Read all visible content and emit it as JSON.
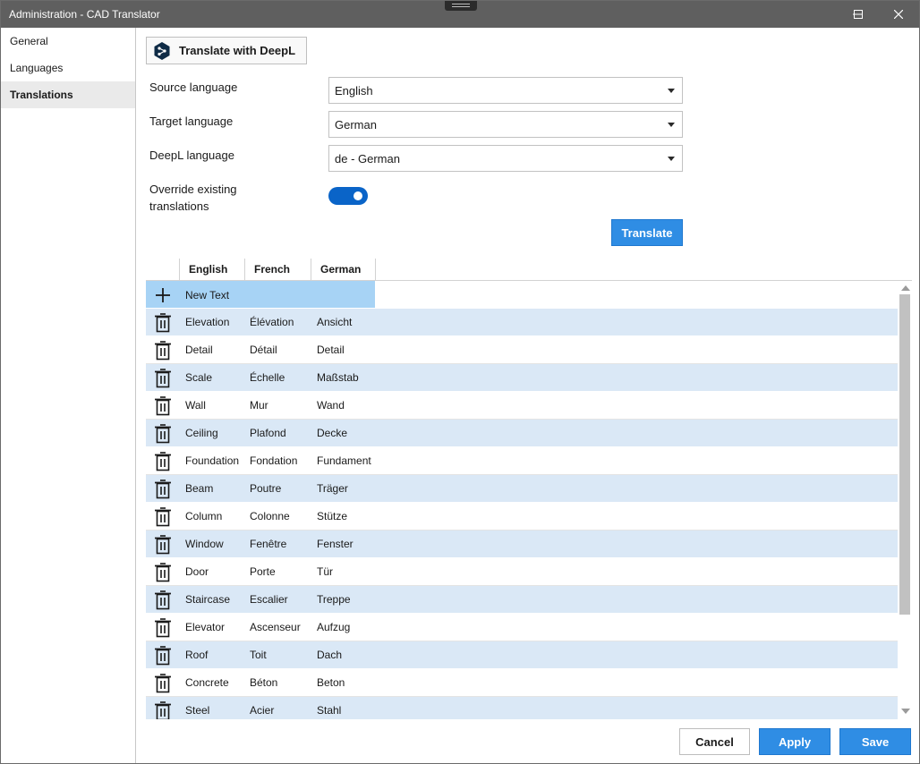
{
  "window": {
    "title": "Administration - CAD Translator"
  },
  "sidebar": {
    "items": [
      {
        "label": "General"
      },
      {
        "label": "Languages"
      },
      {
        "label": "Translations"
      }
    ]
  },
  "deepl_button": {
    "label": "Translate with DeepL",
    "icon": "deepl-logo-icon"
  },
  "form": {
    "source_language_label": "Source language",
    "source_language_value": "English",
    "target_language_label": "Target language",
    "target_language_value": "German",
    "deepl_language_label": "DeepL language",
    "deepl_language_value": "de - German",
    "override_label_line1": "Override existing",
    "override_label_line2": "translations",
    "override_enabled": true,
    "translate_label": "Translate"
  },
  "grid": {
    "columns": [
      "English",
      "French",
      "German"
    ],
    "new_row_label": "New Text",
    "rows": [
      {
        "en": "Elevation",
        "fr": "Élévation",
        "de": "Ansicht"
      },
      {
        "en": "Detail",
        "fr": "Détail",
        "de": "Detail"
      },
      {
        "en": "Scale",
        "fr": "Échelle",
        "de": "Maßstab"
      },
      {
        "en": "Wall",
        "fr": "Mur",
        "de": "Wand"
      },
      {
        "en": "Ceiling",
        "fr": "Plafond",
        "de": "Decke"
      },
      {
        "en": "Foundation",
        "fr": "Fondation",
        "de": "Fundament"
      },
      {
        "en": "Beam",
        "fr": "Poutre",
        "de": "Träger"
      },
      {
        "en": "Column",
        "fr": "Colonne",
        "de": "Stütze"
      },
      {
        "en": "Window",
        "fr": "Fenêtre",
        "de": "Fenster"
      },
      {
        "en": "Door",
        "fr": "Porte",
        "de": "Tür"
      },
      {
        "en": "Staircase",
        "fr": "Escalier",
        "de": "Treppe"
      },
      {
        "en": "Elevator",
        "fr": "Ascenseur",
        "de": "Aufzug"
      },
      {
        "en": "Roof",
        "fr": "Toit",
        "de": "Dach"
      },
      {
        "en": "Concrete",
        "fr": "Béton",
        "de": "Beton"
      },
      {
        "en": "Steel",
        "fr": "Acier",
        "de": "Stahl"
      }
    ]
  },
  "footer": {
    "cancel_label": "Cancel",
    "apply_label": "Apply",
    "save_label": "Save"
  },
  "colors": {
    "accent": "#2f8de4",
    "toggle_on": "#0a64c8",
    "row_alt": "#dae8f6",
    "new_row": "#a7d3f5",
    "titlebar": "#5f5f5f"
  }
}
